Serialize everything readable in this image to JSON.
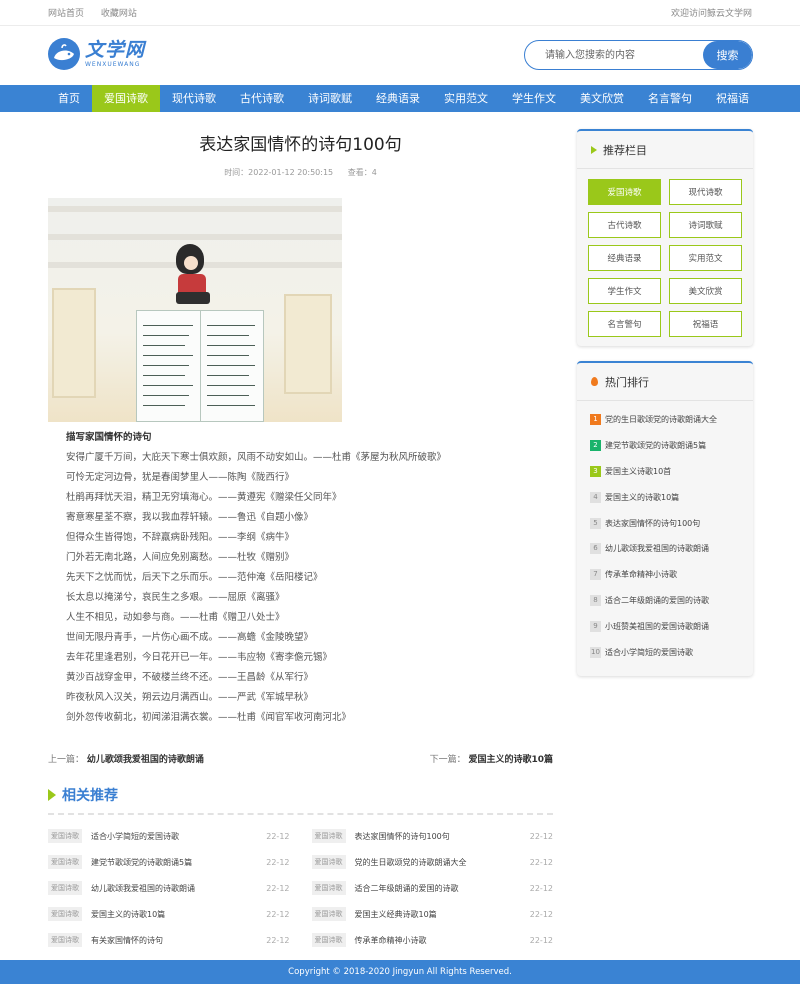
{
  "topbar": {
    "home": "网站首页",
    "favorite": "收藏网站",
    "welcome": "欢迎访问鲸云文学网"
  },
  "logo": {
    "cn": "文学网",
    "en": "WENXUEWANG"
  },
  "search": {
    "placeholder": "请输入您搜索的内容",
    "button": "搜索"
  },
  "nav": {
    "items": [
      "首页",
      "爱国诗歌",
      "现代诗歌",
      "古代诗歌",
      "诗词歌赋",
      "经典语录",
      "实用范文",
      "学生作文",
      "美文欣赏",
      "名言警句",
      "祝福语"
    ],
    "active": "爱国诗歌"
  },
  "article": {
    "title": "表达家国情怀的诗句100句",
    "time": "时间：2022-01-12 20:50:15",
    "views": "查看：4",
    "subtitle": "描写家国情怀的诗句",
    "lines": [
      "安得广厦千万间，大庇天下寒士俱欢颜，风雨不动安如山。——杜甫《茅屋为秋风所破歌》",
      "可怜无定河边骨，犹是春闺梦里人——陈陶《陇西行》",
      "杜鹃再拜忧天泪，精卫无穷填海心。——黄遵宪《赠梁任父同年》",
      "寄意寒星荃不察，我以我血荐轩辕。——鲁迅《自题小像》",
      "但得众生皆得饱，不辞羸病卧残阳。——李纲《病牛》",
      "门外若无南北路，人间应免别离愁。——杜牧《赠别》",
      "先天下之忧而忧，后天下之乐而乐。——范仲淹《岳阳楼记》",
      "长太息以掩涕兮，哀民生之多艰。——屈原《离骚》",
      "人生不相见，动如参与商。——杜甫《赠卫八处士》",
      "世间无限丹青手，一片伤心画不成。——高蟾《金陵晚望》",
      "去年花里逢君别，今日花开已一年。——韦应物《寄李儋元锡》",
      "黄沙百战穿金甲，不破楼兰终不还。——王昌龄《从军行》",
      "昨夜秋风入汉关，朔云边月满西山。——严武《军城早秋》",
      "剑外忽传收蓟北，初闻涕泪满衣裳。——杜甫《闻官军收河南河北》"
    ],
    "prev_label": "上一篇：",
    "prev_title": "幼儿歌颂我爱祖国的诗歌朗诵",
    "next_label": "下一篇：",
    "next_title": "爱国主义的诗歌10篇"
  },
  "related": {
    "heading": "相关推荐",
    "items": [
      {
        "tag": "爱国诗歌",
        "title": "适合小学简短的爱国诗歌",
        "date": "22-12"
      },
      {
        "tag": "爱国诗歌",
        "title": "表达家国情怀的诗句100句",
        "date": "22-12"
      },
      {
        "tag": "爱国诗歌",
        "title": "建党节歌颂党的诗歌朗诵5篇",
        "date": "22-12"
      },
      {
        "tag": "爱国诗歌",
        "title": "党的生日歌颂党的诗歌朗诵大全",
        "date": "22-12"
      },
      {
        "tag": "爱国诗歌",
        "title": "幼儿歌颂我爱祖国的诗歌朗诵",
        "date": "22-12"
      },
      {
        "tag": "爱国诗歌",
        "title": "适合二年级朗诵的爱国的诗歌",
        "date": "22-12"
      },
      {
        "tag": "爱国诗歌",
        "title": "爱国主义的诗歌10篇",
        "date": "22-12"
      },
      {
        "tag": "爱国诗歌",
        "title": "爱国主义经典诗歌10篇",
        "date": "22-12"
      },
      {
        "tag": "爱国诗歌",
        "title": "有关家国情怀的诗句",
        "date": "22-12"
      },
      {
        "tag": "爱国诗歌",
        "title": "传承革命精神小诗歌",
        "date": "22-12"
      }
    ]
  },
  "sidebar": {
    "rec_heading": "推荐栏目",
    "categories": [
      "爱国诗歌",
      "现代诗歌",
      "古代诗歌",
      "诗词歌赋",
      "经典语录",
      "实用范文",
      "学生作文",
      "美文欣赏",
      "名言警句",
      "祝福语"
    ],
    "active_category": "爱国诗歌",
    "hot_heading": "热门排行",
    "hot": [
      "党的生日歌颂党的诗歌朗诵大全",
      "建党节歌颂党的诗歌朗诵5篇",
      "爱国主义诗歌10首",
      "爱国主义的诗歌10篇",
      "表达家国情怀的诗句100句",
      "幼儿歌颂我爱祖国的诗歌朗诵",
      "传承革命精神小诗歌",
      "适合二年级朗诵的爱国的诗歌",
      "小班赞美祖国的爱国诗歌朗诵",
      "适合小学简短的爱国诗歌"
    ]
  },
  "footer": {
    "copyright": "Copyright © 2018-2020 Jingyun All Rights Reserved."
  },
  "colors": {
    "brand": "#3a83d3",
    "accent": "#9ac81a",
    "hot1": "#f07a1e",
    "hot2": "#19b36b"
  }
}
